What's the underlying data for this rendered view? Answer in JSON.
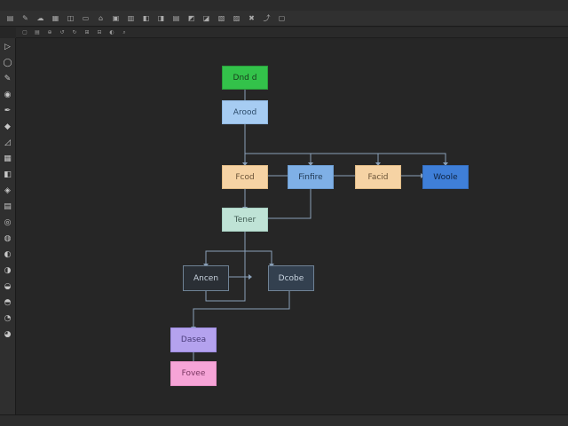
{
  "toolbar": {
    "items": [
      "▤",
      "✎",
      "☁",
      "▦",
      "◫",
      "▭",
      "⌂",
      "▣",
      "▥",
      "◧",
      "◨",
      "▤",
      "◩",
      "◪",
      "▧",
      "▨",
      "✖",
      "⤴",
      "▢"
    ],
    "text_a": "",
    "text_b": ""
  },
  "subbar": {
    "items": [
      "▢",
      "▤",
      "⊕",
      "↺",
      "↻",
      "⊞",
      "⊟",
      "◐",
      "⌕"
    ]
  },
  "left_tools": [
    "▷",
    "◯",
    "✎",
    "◉",
    "✒",
    "◆",
    "◿",
    "▦",
    "◧",
    "◈",
    "▤",
    "◎",
    "◍",
    "◐",
    "◑",
    "◒",
    "◓",
    "◔",
    "◕"
  ],
  "nodes": {
    "start": "Dnd d",
    "second": "Arood",
    "row3_a": "Fcod",
    "row3_b": "Finfire",
    "row3_c": "Facid",
    "row3_d": "Woole",
    "mid": "Tener",
    "left_dark": "Ancen",
    "right_dark": "Dcobe",
    "purple": "Dasea",
    "pink": "Fovee"
  },
  "colors": {
    "green": "#33c24a",
    "blue_light": "#a6ccf2",
    "peach": "#f6d3a4",
    "blue_mid": "#7fb0e6",
    "blue_dark": "#3f7fd8",
    "mint": "#bfe3d6",
    "dark_node": "#2a2f35",
    "dark_node2": "#33404f",
    "purple": "#b4a2ee",
    "pink": "#f6a4d7"
  },
  "status": {
    "left": "",
    "middle": "",
    "right": ""
  }
}
